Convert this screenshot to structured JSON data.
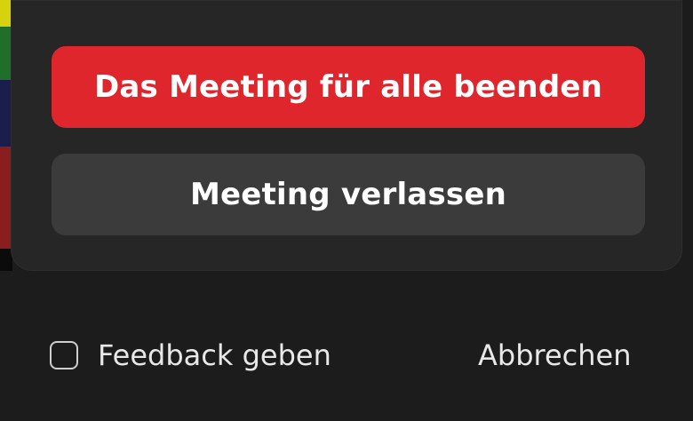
{
  "dialog": {
    "end_for_all_label": "Das Meeting für alle beenden",
    "leave_label": "Meeting verlassen"
  },
  "footer": {
    "feedback_label": "Feedback geben",
    "feedback_checked": false,
    "cancel_label": "Abbrechen"
  },
  "colors": {
    "danger": "#e0262d",
    "secondary_button": "#3b3b3b",
    "panel": "#262626",
    "background": "#1c1c1c",
    "text": "#e8e8e8"
  }
}
